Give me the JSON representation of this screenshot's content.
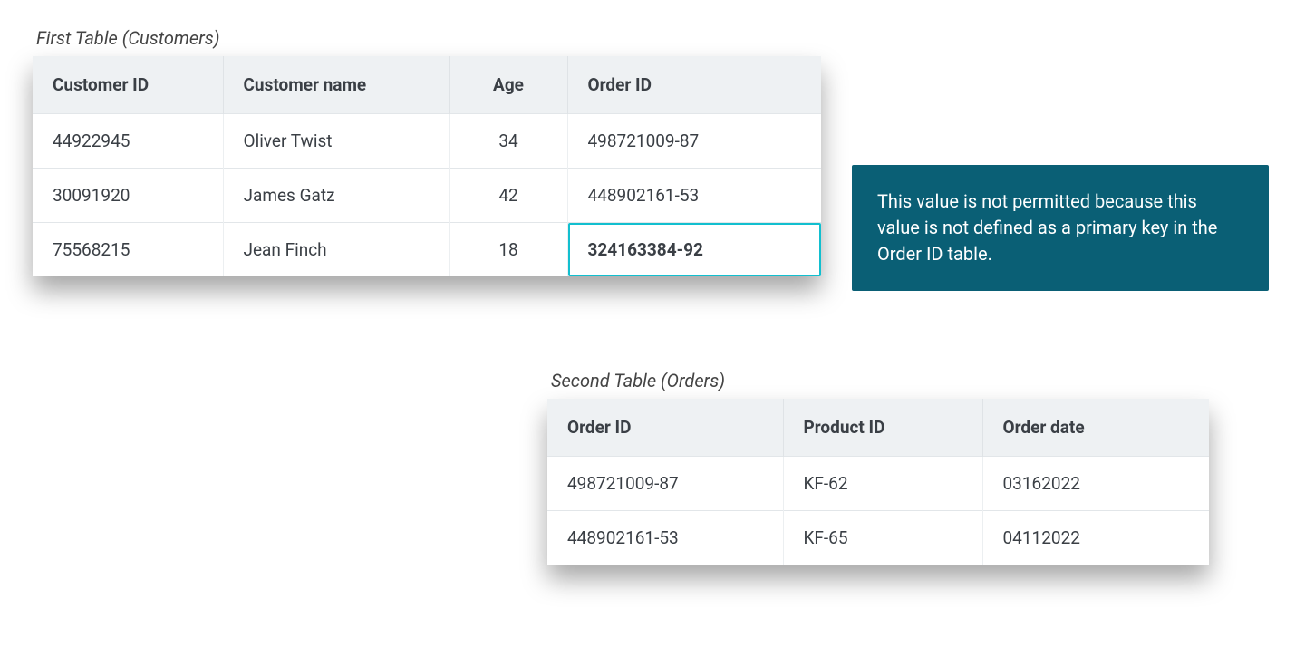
{
  "first": {
    "caption": "First Table (Customers)",
    "headers": [
      "Customer ID",
      "Customer name",
      "Age",
      "Order ID"
    ],
    "rows": [
      {
        "id": "44922945",
        "name": "Oliver Twist",
        "age": "34",
        "order": "498721009-87"
      },
      {
        "id": "30091920",
        "name": "James Gatz",
        "age": "42",
        "order": "448902161-53"
      },
      {
        "id": "75568215",
        "name": "Jean Finch",
        "age": "18",
        "order": "324163384-92"
      }
    ],
    "highlight_row_index": 2,
    "highlight_col": "order"
  },
  "second": {
    "caption": "Second Table (Orders)",
    "headers": [
      "Order ID",
      "Product ID",
      "Order date"
    ],
    "rows": [
      {
        "order": "498721009-87",
        "product": "KF-62",
        "date": "03162022"
      },
      {
        "order": "448902161-53",
        "product": "KF-65",
        "date": "04112022"
      }
    ]
  },
  "callout": {
    "text": "This value is not permitted because this value is not defined as a primary key in the Order ID table."
  }
}
